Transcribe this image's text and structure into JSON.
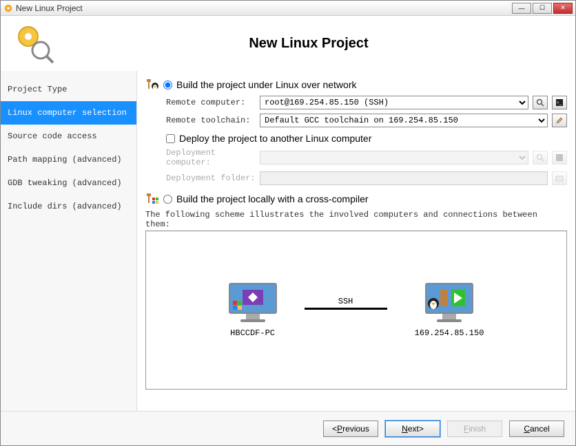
{
  "window": {
    "title": "New Linux Project"
  },
  "header": {
    "title": "New Linux Project"
  },
  "sidebar": {
    "items": [
      {
        "label": "Project Type"
      },
      {
        "label": "Linux computer selection"
      },
      {
        "label": "Source code access"
      },
      {
        "label": "Path mapping (advanced)"
      },
      {
        "label": "GDB tweaking (advanced)"
      },
      {
        "label": "Include dirs (advanced)"
      }
    ],
    "selected_index": 1
  },
  "options": {
    "remote": {
      "label": "Build the project under Linux over network",
      "checked": true,
      "remote_computer_label": "Remote computer:",
      "remote_computer_value": "root@169.254.85.150 (SSH)",
      "remote_toolchain_label": "Remote toolchain:",
      "remote_toolchain_value": "Default GCC toolchain on 169.254.85.150"
    },
    "deploy": {
      "label": "Deploy the project to another Linux computer",
      "checked": false,
      "deployment_computer_label": "Deployment computer:",
      "deployment_computer_value": "",
      "deployment_folder_label": "Deployment folder:",
      "deployment_folder_value": ""
    },
    "cross": {
      "label": "Build the project locally with a cross-compiler",
      "checked": false
    }
  },
  "scheme": {
    "text": "The following scheme illustrates the involved computers and connections between them:",
    "local_name": "HBCCDF-PC",
    "remote_name": "169.254.85.150",
    "connection": "SSH"
  },
  "footer": {
    "previous": "Previous",
    "next": "Next",
    "finish": "Finish",
    "cancel": "Cancel"
  }
}
